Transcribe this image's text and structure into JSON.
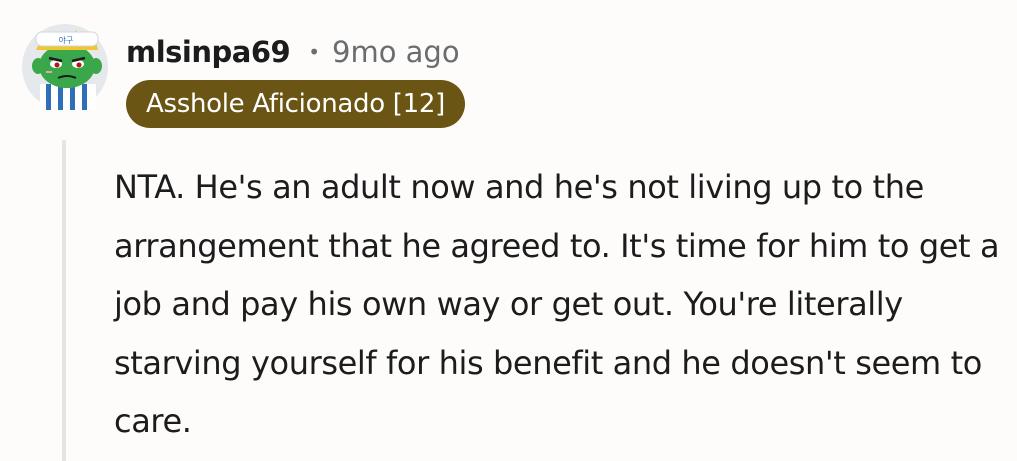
{
  "comment": {
    "author": "mlsinpa69",
    "separator": "•",
    "timestamp": "9mo ago",
    "flair": "Asshole Aficionado [12]",
    "avatar_icon": "snoo-avatar-icon",
    "avatar_hat_text": "야구",
    "body": "NTA. He's an adult now and he's not living up to the arrangement that he agreed to. It's time for him to get a job and pay his own way or get out. You're literally starving yourself for his benefit and he doesn't seem to care."
  },
  "colors": {
    "flair_bg": "#6b5514",
    "flair_text": "#ffffff",
    "meta_text": "#6a6d70",
    "thread_line": "#e8e4df",
    "avatar_bg": "#e6e9ec",
    "avatar_skin": "#3aa84a"
  }
}
